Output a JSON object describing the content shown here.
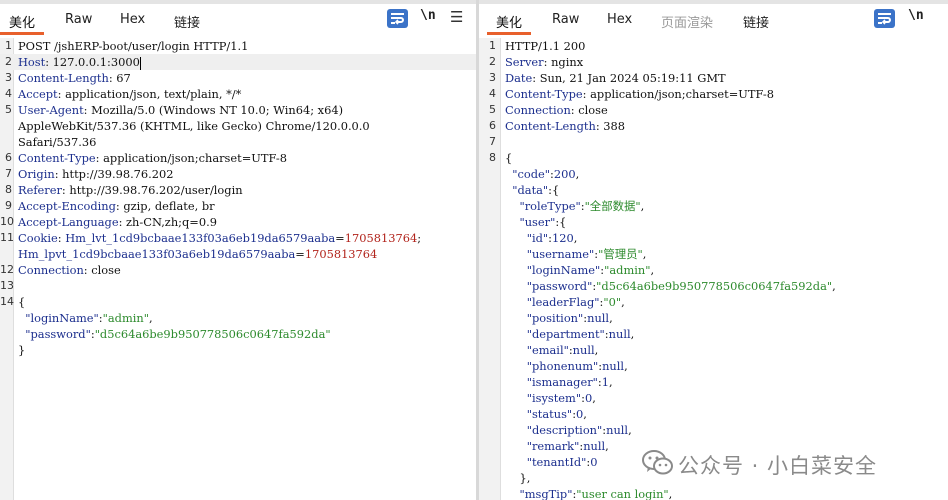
{
  "request_pane": {
    "tabs": [
      "美化",
      "Raw",
      "Hex",
      "链接"
    ],
    "newline_toggle": "\\n",
    "lines": [
      {
        "n": "1",
        "parts": [
          {
            "t": "POST /jshERP-boot/user/login HTTP/1.1",
            "c": ""
          }
        ]
      },
      {
        "n": "2",
        "parts": [
          {
            "t": "Host",
            "c": "hn"
          },
          {
            "t": ": 127.0.0.1:3000",
            "c": ""
          }
        ],
        "highlight": true,
        "cursor": true
      },
      {
        "n": "3",
        "parts": [
          {
            "t": "Content-Length",
            "c": "hn"
          },
          {
            "t": ": 67",
            "c": ""
          }
        ]
      },
      {
        "n": "4",
        "parts": [
          {
            "t": "Accept",
            "c": "hn"
          },
          {
            "t": ": application/json, text/plain, */*",
            "c": ""
          }
        ]
      },
      {
        "n": "5",
        "parts": [
          {
            "t": "User-Agent",
            "c": "hn"
          },
          {
            "t": ": Mozilla/5.0 (Windows NT 10.0; Win64; x64)",
            "c": ""
          }
        ]
      },
      {
        "n": "",
        "parts": [
          {
            "t": "AppleWebKit/537.36 (KHTML, like Gecko) Chrome/120.0.0.0",
            "c": ""
          }
        ]
      },
      {
        "n": "",
        "parts": [
          {
            "t": "Safari/537.36",
            "c": ""
          }
        ]
      },
      {
        "n": "6",
        "parts": [
          {
            "t": "Content-Type",
            "c": "hn"
          },
          {
            "t": ": application/json;charset=UTF-8",
            "c": ""
          }
        ]
      },
      {
        "n": "7",
        "parts": [
          {
            "t": "Origin",
            "c": "hn"
          },
          {
            "t": ": http://39.98.76.202",
            "c": ""
          }
        ]
      },
      {
        "n": "8",
        "parts": [
          {
            "t": "Referer",
            "c": "hn"
          },
          {
            "t": ": http://39.98.76.202/user/login",
            "c": ""
          }
        ]
      },
      {
        "n": "9",
        "parts": [
          {
            "t": "Accept-Encoding",
            "c": "hn"
          },
          {
            "t": ": gzip, deflate, br",
            "c": ""
          }
        ]
      },
      {
        "n": "10",
        "parts": [
          {
            "t": "Accept-Language",
            "c": "hn"
          },
          {
            "t": ": zh-CN,zh;q=0.9",
            "c": ""
          }
        ]
      },
      {
        "n": "11",
        "parts": [
          {
            "t": "Cookie",
            "c": "hn"
          },
          {
            "t": ": ",
            "c": ""
          },
          {
            "t": "Hm_lvt_1cd9bcbaae133f03a6eb19da6579aaba",
            "c": "hn"
          },
          {
            "t": "=",
            "c": ""
          },
          {
            "t": "1705813764",
            "c": "cv"
          },
          {
            "t": ";",
            "c": ""
          }
        ]
      },
      {
        "n": "",
        "parts": [
          {
            "t": "Hm_lpvt_1cd9bcbaae133f03a6eb19da6579aaba",
            "c": "hn"
          },
          {
            "t": "=",
            "c": ""
          },
          {
            "t": "1705813764",
            "c": "cv"
          }
        ]
      },
      {
        "n": "12",
        "parts": [
          {
            "t": "Connection",
            "c": "hn"
          },
          {
            "t": ": close",
            "c": ""
          }
        ]
      },
      {
        "n": "13",
        "parts": []
      },
      {
        "n": "14",
        "parts": [
          {
            "t": "{",
            "c": ""
          }
        ]
      },
      {
        "n": "",
        "parts": [
          {
            "t": "  \"loginName\"",
            "c": "jk"
          },
          {
            "t": ":",
            "c": ""
          },
          {
            "t": "\"admin\"",
            "c": "js"
          },
          {
            "t": ",",
            "c": ""
          }
        ]
      },
      {
        "n": "",
        "parts": [
          {
            "t": "  \"password\"",
            "c": "jk"
          },
          {
            "t": ":",
            "c": ""
          },
          {
            "t": "\"d5c64a6be9b950778506c0647fa592da\"",
            "c": "js"
          }
        ]
      },
      {
        "n": "",
        "parts": [
          {
            "t": "}",
            "c": ""
          }
        ]
      }
    ]
  },
  "response_pane": {
    "tabs": [
      "美化",
      "Raw",
      "Hex",
      "页面渲染",
      "链接"
    ],
    "newline_toggle": "\\n",
    "lines": [
      {
        "n": "1",
        "parts": [
          {
            "t": "HTTP/1.1 200",
            "c": ""
          }
        ]
      },
      {
        "n": "2",
        "parts": [
          {
            "t": "Server",
            "c": "hn"
          },
          {
            "t": ": nginx",
            "c": ""
          }
        ]
      },
      {
        "n": "3",
        "parts": [
          {
            "t": "Date",
            "c": "hn"
          },
          {
            "t": ": Sun, 21 Jan 2024 05:19:11 GMT",
            "c": ""
          }
        ]
      },
      {
        "n": "4",
        "parts": [
          {
            "t": "Content-Type",
            "c": "hn"
          },
          {
            "t": ": application/json;charset=UTF-8",
            "c": ""
          }
        ]
      },
      {
        "n": "5",
        "parts": [
          {
            "t": "Connection",
            "c": "hn"
          },
          {
            "t": ": close",
            "c": ""
          }
        ]
      },
      {
        "n": "6",
        "parts": [
          {
            "t": "Content-Length",
            "c": "hn"
          },
          {
            "t": ": 388",
            "c": ""
          }
        ]
      },
      {
        "n": "7",
        "parts": []
      },
      {
        "n": "8",
        "parts": [
          {
            "t": "{",
            "c": ""
          }
        ]
      },
      {
        "n": "",
        "parts": [
          {
            "t": "  \"code\"",
            "c": "jk"
          },
          {
            "t": ":",
            "c": ""
          },
          {
            "t": "200",
            "c": "jn"
          },
          {
            "t": ",",
            "c": ""
          }
        ]
      },
      {
        "n": "",
        "parts": [
          {
            "t": "  \"data\"",
            "c": "jk"
          },
          {
            "t": ":{",
            "c": ""
          }
        ]
      },
      {
        "n": "",
        "parts": [
          {
            "t": "    \"roleType\"",
            "c": "jk"
          },
          {
            "t": ":",
            "c": ""
          },
          {
            "t": "\"全部数据\"",
            "c": "js"
          },
          {
            "t": ",",
            "c": ""
          }
        ]
      },
      {
        "n": "",
        "parts": [
          {
            "t": "    \"user\"",
            "c": "jk"
          },
          {
            "t": ":{",
            "c": ""
          }
        ]
      },
      {
        "n": "",
        "parts": [
          {
            "t": "      \"id\"",
            "c": "jk"
          },
          {
            "t": ":",
            "c": ""
          },
          {
            "t": "120",
            "c": "jn"
          },
          {
            "t": ",",
            "c": ""
          }
        ]
      },
      {
        "n": "",
        "parts": [
          {
            "t": "      \"username\"",
            "c": "jk"
          },
          {
            "t": ":",
            "c": ""
          },
          {
            "t": "\"管理员\"",
            "c": "js"
          },
          {
            "t": ",",
            "c": ""
          }
        ]
      },
      {
        "n": "",
        "parts": [
          {
            "t": "      \"loginName\"",
            "c": "jk"
          },
          {
            "t": ":",
            "c": ""
          },
          {
            "t": "\"admin\"",
            "c": "js"
          },
          {
            "t": ",",
            "c": ""
          }
        ]
      },
      {
        "n": "",
        "parts": [
          {
            "t": "      \"password\"",
            "c": "jk"
          },
          {
            "t": ":",
            "c": ""
          },
          {
            "t": "\"d5c64a6be9b950778506c0647fa592da\"",
            "c": "js"
          },
          {
            "t": ",",
            "c": ""
          }
        ]
      },
      {
        "n": "",
        "parts": [
          {
            "t": "      \"leaderFlag\"",
            "c": "jk"
          },
          {
            "t": ":",
            "c": ""
          },
          {
            "t": "\"0\"",
            "c": "js"
          },
          {
            "t": ",",
            "c": ""
          }
        ]
      },
      {
        "n": "",
        "parts": [
          {
            "t": "      \"position\"",
            "c": "jk"
          },
          {
            "t": ":",
            "c": ""
          },
          {
            "t": "null",
            "c": "jn"
          },
          {
            "t": ",",
            "c": ""
          }
        ]
      },
      {
        "n": "",
        "parts": [
          {
            "t": "      \"department\"",
            "c": "jk"
          },
          {
            "t": ":",
            "c": ""
          },
          {
            "t": "null",
            "c": "jn"
          },
          {
            "t": ",",
            "c": ""
          }
        ]
      },
      {
        "n": "",
        "parts": [
          {
            "t": "      \"email\"",
            "c": "jk"
          },
          {
            "t": ":",
            "c": ""
          },
          {
            "t": "null",
            "c": "jn"
          },
          {
            "t": ",",
            "c": ""
          }
        ]
      },
      {
        "n": "",
        "parts": [
          {
            "t": "      \"phonenum\"",
            "c": "jk"
          },
          {
            "t": ":",
            "c": ""
          },
          {
            "t": "null",
            "c": "jn"
          },
          {
            "t": ",",
            "c": ""
          }
        ]
      },
      {
        "n": "",
        "parts": [
          {
            "t": "      \"ismanager\"",
            "c": "jk"
          },
          {
            "t": ":",
            "c": ""
          },
          {
            "t": "1",
            "c": "jn"
          },
          {
            "t": ",",
            "c": ""
          }
        ]
      },
      {
        "n": "",
        "parts": [
          {
            "t": "      \"isystem\"",
            "c": "jk"
          },
          {
            "t": ":",
            "c": ""
          },
          {
            "t": "0",
            "c": "jn"
          },
          {
            "t": ",",
            "c": ""
          }
        ]
      },
      {
        "n": "",
        "parts": [
          {
            "t": "      \"status\"",
            "c": "jk"
          },
          {
            "t": ":",
            "c": ""
          },
          {
            "t": "0",
            "c": "jn"
          },
          {
            "t": ",",
            "c": ""
          }
        ]
      },
      {
        "n": "",
        "parts": [
          {
            "t": "      \"description\"",
            "c": "jk"
          },
          {
            "t": ":",
            "c": ""
          },
          {
            "t": "null",
            "c": "jn"
          },
          {
            "t": ",",
            "c": ""
          }
        ]
      },
      {
        "n": "",
        "parts": [
          {
            "t": "      \"remark\"",
            "c": "jk"
          },
          {
            "t": ":",
            "c": ""
          },
          {
            "t": "null",
            "c": "jn"
          },
          {
            "t": ",",
            "c": ""
          }
        ]
      },
      {
        "n": "",
        "parts": [
          {
            "t": "      \"tenantId\"",
            "c": "jk"
          },
          {
            "t": ":",
            "c": ""
          },
          {
            "t": "0",
            "c": "jn"
          }
        ]
      },
      {
        "n": "",
        "parts": [
          {
            "t": "    },",
            "c": ""
          }
        ]
      },
      {
        "n": "",
        "parts": [
          {
            "t": "    \"msgTip\"",
            "c": "jk"
          },
          {
            "t": ":",
            "c": ""
          },
          {
            "t": "\"user can login\"",
            "c": "js"
          },
          {
            "t": ",",
            "c": ""
          }
        ]
      }
    ]
  },
  "watermark": {
    "text": "公众号 · 小白菜安全",
    "icon": "wechat-icon"
  },
  "colors": {
    "accent": "#e8602c",
    "button_blue": "#3b73c8",
    "header_name": "#1c2f8e",
    "cookie_value": "#b2241c",
    "json_string": "#2c8a2c"
  }
}
